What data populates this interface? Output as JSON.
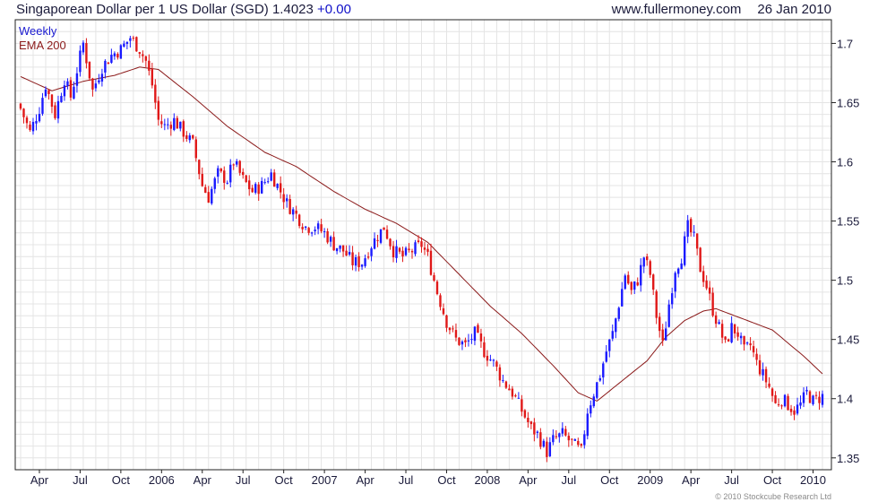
{
  "header": {
    "title": "Singaporean Dollar per 1 US Dollar (SGD)",
    "last_price": "1.4023",
    "change": "+0.00",
    "source": "www.fullermoney.com",
    "date": "26 Jan 2010"
  },
  "credit": "© 2010 Stockcube Research Ltd",
  "colors": {
    "up": "#1a1aff",
    "down": "#e01818",
    "ema": "#8b1a1a",
    "grid": "#e4e4e4",
    "frame": "#222222"
  },
  "chart_data": {
    "type": "candlestick",
    "interval_label": "Weekly",
    "overlay_label": "EMA 200",
    "ylim": [
      1.34,
      1.72
    ],
    "y_ticks": [
      1.35,
      1.4,
      1.45,
      1.5,
      1.55,
      1.6,
      1.65,
      1.7
    ],
    "x_tick_labels": [
      "Apr",
      "Jul",
      "Oct",
      "2006",
      "Apr",
      "Jul",
      "Oct",
      "2007",
      "Apr",
      "Jul",
      "Oct",
      "2008",
      "Apr",
      "Jul",
      "Oct",
      "2009",
      "Apr",
      "Jul",
      "Oct",
      "2010"
    ],
    "x_ticks_week_index": [
      6,
      19,
      32,
      45,
      58,
      71,
      84,
      97,
      110,
      123,
      136,
      149,
      162,
      175,
      188,
      201,
      214,
      227,
      240,
      253
    ],
    "close_anchors": [
      [
        0,
        1.645
      ],
      [
        3,
        1.625
      ],
      [
        6,
        1.645
      ],
      [
        8,
        1.665
      ],
      [
        11,
        1.64
      ],
      [
        14,
        1.67
      ],
      [
        16,
        1.655
      ],
      [
        20,
        1.7
      ],
      [
        23,
        1.66
      ],
      [
        26,
        1.68
      ],
      [
        29,
        1.69
      ],
      [
        32,
        1.695
      ],
      [
        35,
        1.705
      ],
      [
        38,
        1.695
      ],
      [
        40,
        1.685
      ],
      [
        42,
        1.665
      ],
      [
        44,
        1.635
      ],
      [
        46,
        1.63
      ],
      [
        49,
        1.635
      ],
      [
        52,
        1.625
      ],
      [
        55,
        1.615
      ],
      [
        58,
        1.58
      ],
      [
        60,
        1.57
      ],
      [
        63,
        1.59
      ],
      [
        66,
        1.585
      ],
      [
        68,
        1.6
      ],
      [
        71,
        1.585
      ],
      [
        74,
        1.575
      ],
      [
        77,
        1.58
      ],
      [
        80,
        1.59
      ],
      [
        83,
        1.575
      ],
      [
        85,
        1.565
      ],
      [
        88,
        1.555
      ],
      [
        91,
        1.545
      ],
      [
        94,
        1.545
      ],
      [
        97,
        1.54
      ],
      [
        100,
        1.53
      ],
      [
        103,
        1.525
      ],
      [
        106,
        1.515
      ],
      [
        109,
        1.515
      ],
      [
        112,
        1.53
      ],
      [
        116,
        1.545
      ],
      [
        119,
        1.525
      ],
      [
        122,
        1.52
      ],
      [
        125,
        1.525
      ],
      [
        128,
        1.53
      ],
      [
        130,
        1.52
      ],
      [
        133,
        1.49
      ],
      [
        136,
        1.465
      ],
      [
        139,
        1.45
      ],
      [
        142,
        1.445
      ],
      [
        145,
        1.455
      ],
      [
        148,
        1.44
      ],
      [
        151,
        1.43
      ],
      [
        154,
        1.415
      ],
      [
        157,
        1.405
      ],
      [
        160,
        1.39
      ],
      [
        163,
        1.375
      ],
      [
        165,
        1.37
      ],
      [
        168,
        1.355
      ],
      [
        170,
        1.365
      ],
      [
        173,
        1.37
      ],
      [
        175,
        1.365
      ],
      [
        177,
        1.36
      ],
      [
        179,
        1.355
      ],
      [
        181,
        1.39
      ],
      [
        183,
        1.405
      ],
      [
        185,
        1.42
      ],
      [
        187,
        1.44
      ],
      [
        189,
        1.455
      ],
      [
        191,
        1.48
      ],
      [
        193,
        1.505
      ],
      [
        195,
        1.49
      ],
      [
        197,
        1.5
      ],
      [
        199,
        1.52
      ],
      [
        201,
        1.505
      ],
      [
        203,
        1.47
      ],
      [
        205,
        1.445
      ],
      [
        207,
        1.48
      ],
      [
        209,
        1.51
      ],
      [
        211,
        1.52
      ],
      [
        213,
        1.545
      ],
      [
        215,
        1.535
      ],
      [
        217,
        1.51
      ],
      [
        219,
        1.495
      ],
      [
        221,
        1.475
      ],
      [
        223,
        1.46
      ],
      [
        225,
        1.445
      ],
      [
        227,
        1.46
      ],
      [
        229,
        1.455
      ],
      [
        231,
        1.44
      ],
      [
        233,
        1.445
      ],
      [
        235,
        1.43
      ],
      [
        237,
        1.42
      ],
      [
        239,
        1.41
      ],
      [
        241,
        1.395
      ],
      [
        243,
        1.4
      ],
      [
        245,
        1.395
      ],
      [
        247,
        1.39
      ],
      [
        249,
        1.395
      ],
      [
        251,
        1.405
      ],
      [
        253,
        1.398
      ],
      [
        256,
        1.402
      ]
    ],
    "ema_anchors": [
      [
        0,
        1.672
      ],
      [
        10,
        1.66
      ],
      [
        20,
        1.668
      ],
      [
        30,
        1.673
      ],
      [
        38,
        1.68
      ],
      [
        44,
        1.678
      ],
      [
        55,
        1.655
      ],
      [
        66,
        1.63
      ],
      [
        78,
        1.608
      ],
      [
        88,
        1.596
      ],
      [
        100,
        1.575
      ],
      [
        110,
        1.56
      ],
      [
        120,
        1.548
      ],
      [
        130,
        1.532
      ],
      [
        140,
        1.505
      ],
      [
        150,
        1.478
      ],
      [
        160,
        1.455
      ],
      [
        170,
        1.428
      ],
      [
        178,
        1.405
      ],
      [
        184,
        1.398
      ],
      [
        192,
        1.415
      ],
      [
        200,
        1.432
      ],
      [
        206,
        1.452
      ],
      [
        212,
        1.466
      ],
      [
        218,
        1.474
      ],
      [
        222,
        1.476
      ],
      [
        230,
        1.468
      ],
      [
        240,
        1.458
      ],
      [
        250,
        1.436
      ],
      [
        256,
        1.421
      ]
    ]
  }
}
